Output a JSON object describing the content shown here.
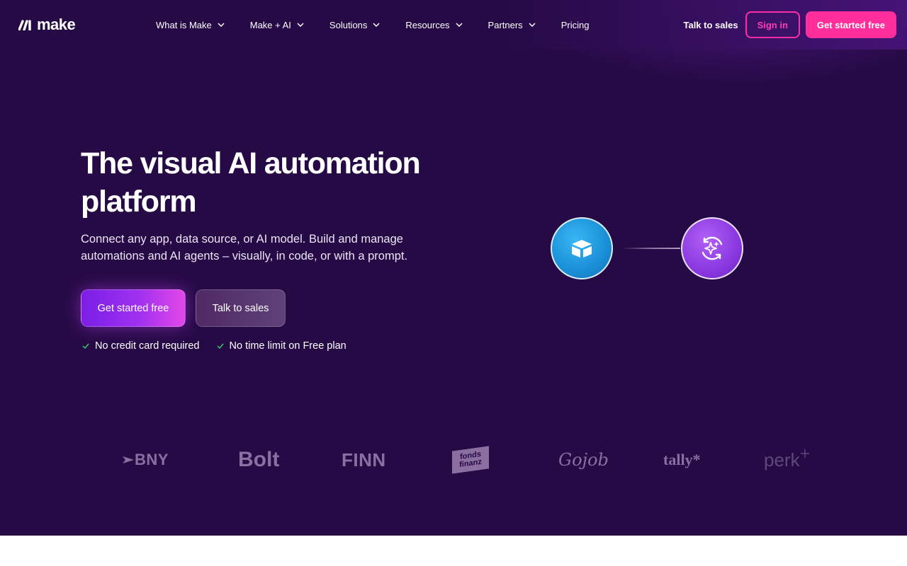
{
  "brand": {
    "name": "make"
  },
  "nav": {
    "items": [
      {
        "label": "What is Make",
        "dropdown": true
      },
      {
        "label": "Make + AI",
        "dropdown": true
      },
      {
        "label": "Solutions",
        "dropdown": true
      },
      {
        "label": "Resources",
        "dropdown": true
      },
      {
        "label": "Partners",
        "dropdown": true
      },
      {
        "label": "Pricing",
        "dropdown": false
      }
    ],
    "talk_to_sales": "Talk to sales",
    "sign_in": "Sign in",
    "get_started": "Get started free"
  },
  "hero": {
    "title_line1": "The visual AI automation",
    "title_line2": "platform",
    "subtitle_line1": "Connect any app, data source, or AI model. Build and manage",
    "subtitle_line2": "automations and AI agents – visually, in code, or with a prompt.",
    "cta_primary": "Get started free",
    "cta_secondary": "Talk to sales",
    "perks": [
      "No credit card required",
      "No time limit on Free plan"
    ]
  },
  "logos": {
    "bny": "BNY",
    "bolt": "Bolt",
    "finn": "FINN",
    "fonds_top": "fonds",
    "fonds_bottom": "finanz",
    "gojob": "Gojob",
    "tally": "tally*",
    "perk": "perk"
  },
  "colors": {
    "hero_bg": "#260a46",
    "accent_pink": "#ff2e9a",
    "node_blue": "#1a8fd6",
    "node_purple": "#8a38e0"
  }
}
